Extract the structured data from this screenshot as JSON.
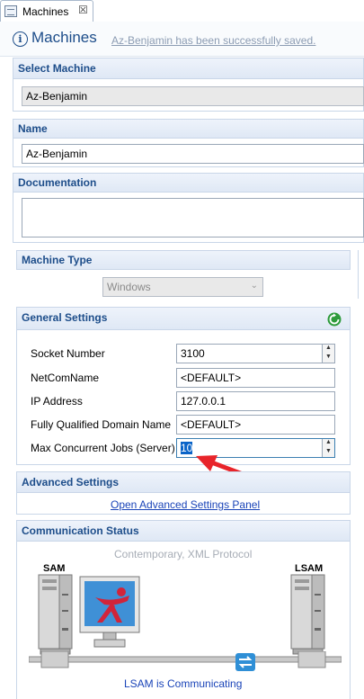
{
  "tab": {
    "label": "Machines",
    "close": "☒"
  },
  "header": {
    "title": "Machines",
    "status": "Az-Benjamin has been successfully saved."
  },
  "select_machine": {
    "title": "Select Machine",
    "value": "Az-Benjamin"
  },
  "name": {
    "title": "Name",
    "value": "Az-Benjamin"
  },
  "documentation": {
    "title": "Documentation",
    "value": ""
  },
  "machine_type": {
    "title": "Machine Type",
    "value": "Windows"
  },
  "general_settings": {
    "title": "General Settings",
    "rows": [
      {
        "label": "Socket Number",
        "value": "3100"
      },
      {
        "label": "NetComName",
        "value": "<DEFAULT>"
      },
      {
        "label": "IP Address",
        "value": "127.0.0.1"
      },
      {
        "label": "Fully Qualified Domain Name",
        "value": "<DEFAULT>"
      },
      {
        "label": "Max Concurrent Jobs (Server)",
        "value": "10"
      }
    ]
  },
  "advanced_settings": {
    "title": "Advanced Settings",
    "link": "Open Advanced Settings Panel"
  },
  "communication": {
    "title": "Communication Status",
    "protocol": "Contemporary, XML Protocol",
    "left_label": "SAM",
    "right_label": "LSAM",
    "status": "LSAM is Communicating"
  },
  "colors": {
    "accent": "#1d4d8a",
    "link": "#1a44b8",
    "arrow": "#e8242a",
    "refresh": "#2e9b3c"
  }
}
